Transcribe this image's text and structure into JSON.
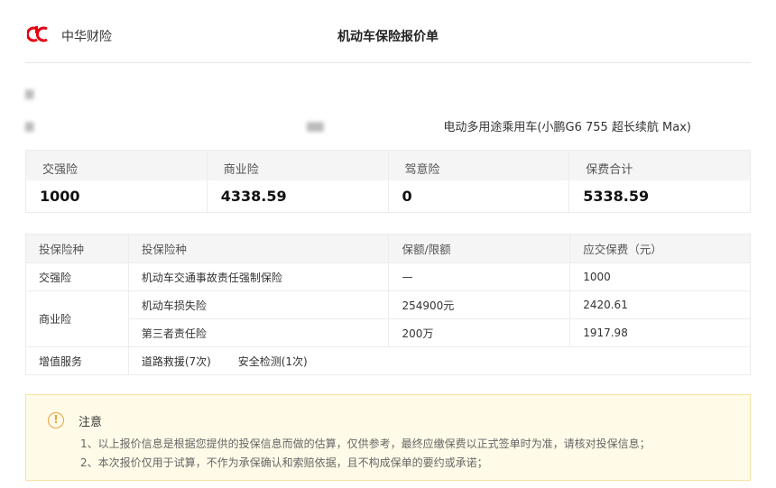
{
  "header": {
    "company": "中华财险",
    "title": "机动车保险报价单",
    "logo_color": "#e60012"
  },
  "vehicle": {
    "description": "电动多用途乘用车(小鹏G6 755 超长续航 Max)"
  },
  "summary": [
    {
      "label": "交强险",
      "value": "1000"
    },
    {
      "label": "商业险",
      "value": "4338.59"
    },
    {
      "label": "驾意险",
      "value": "0"
    },
    {
      "label": "保费合计",
      "value": "5338.59"
    }
  ],
  "detail": {
    "headers": [
      "投保险种",
      "投保险种",
      "保额/限额",
      "应交保费（元）"
    ],
    "rows": [
      {
        "category": "交强险",
        "name": "机动车交通事故责任强制保险",
        "limit": "—",
        "premium": "1000"
      },
      {
        "category": "商业险",
        "name": "机动车损失险",
        "limit": "254900元",
        "premium": "2420.61"
      },
      {
        "category": "",
        "name": "第三者责任险",
        "limit": "200万",
        "premium": "1917.98"
      }
    ],
    "services": {
      "category": "增值服务",
      "items": [
        "道路救援(7次)",
        "安全检测(1次)"
      ]
    }
  },
  "notice": {
    "title": "注意",
    "icon_color": "#e8a33d",
    "lines": [
      "1、以上报价信息是根据您提供的投保信息而做的估算，仅供参考，最终应缴保费以正式签单时为准，请核对投保信息；",
      "2、本次报价仅用于试算，不作为承保确认和索赔依据，且不构成保单的要约或承诺；"
    ]
  }
}
